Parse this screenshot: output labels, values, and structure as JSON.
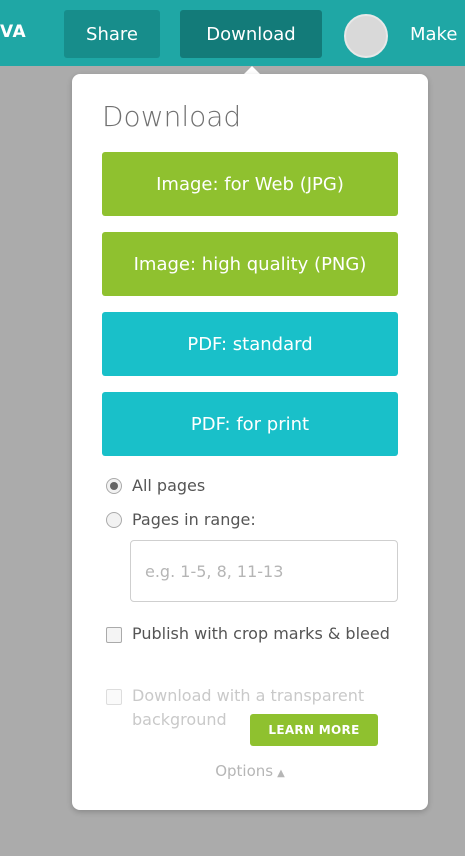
{
  "topbar": {
    "brand": "VA",
    "share_label": "Share",
    "download_label": "Download",
    "make_label": "Make"
  },
  "panel": {
    "title": "Download",
    "buttons": [
      "Image: for Web (JPG)",
      "Image: high quality (PNG)",
      "PDF: standard",
      "PDF: for print"
    ],
    "pages": {
      "all_label": "All pages",
      "range_label": "Pages in range:",
      "selected": "All pages",
      "range_placeholder": "e.g. 1-5, 8, 11-13"
    },
    "crop_marks_label": "Publish with crop marks & bleed",
    "transparent_label": "Download with a transparent background",
    "learn_more_label": "LEARN MORE",
    "options_label": "Options",
    "options_caret": "▲"
  },
  "colors": {
    "topbar": "#1fa7a5",
    "green_button": "#8fc12f",
    "teal_button": "#19c0c9",
    "backdrop": "#ababab"
  }
}
